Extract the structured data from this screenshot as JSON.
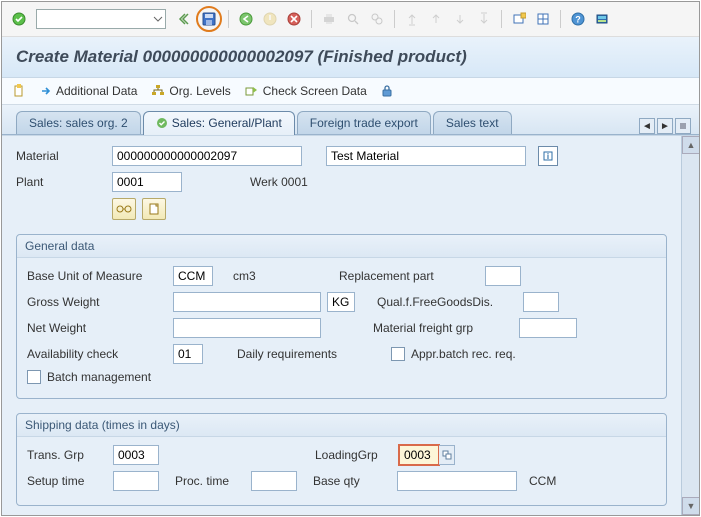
{
  "toolbar": {
    "combo_value": ""
  },
  "title": "Create Material 000000000000002097 (Finished product)",
  "subtoolbar": {
    "additional_data": "Additional Data",
    "org_levels": "Org. Levels",
    "check_screen": "Check Screen Data"
  },
  "tabs": {
    "t1": "Sales: sales org. 2",
    "t2": "Sales: General/Plant",
    "t3": "Foreign trade export",
    "t4": "Sales text"
  },
  "header": {
    "material_label": "Material",
    "material_value": "000000000000002097",
    "material_desc": "Test Material",
    "plant_label": "Plant",
    "plant_value": "0001",
    "plant_desc": "Werk 0001"
  },
  "general": {
    "title": "General data",
    "uom_label": "Base Unit of Measure",
    "uom_value": "CCM",
    "uom_desc": "cm3",
    "replacement_label": "Replacement part",
    "gross_label": "Gross Weight",
    "gross_value": "",
    "gross_unit": "KG",
    "qualfree_label": "Qual.f.FreeGoodsDis.",
    "net_label": "Net Weight",
    "net_value": "",
    "mfg_label": "Material freight grp",
    "mfg_value": "",
    "avail_label": "Availability check",
    "avail_value": "01",
    "avail_desc": "Daily requirements",
    "apprbatch_label": "Appr.batch rec. req.",
    "batchmgmt_label": "Batch management"
  },
  "shipping": {
    "title": "Shipping data (times in days)",
    "transgrp_label": "Trans. Grp",
    "transgrp_value": "0003",
    "loadgrp_label": "LoadingGrp",
    "loadgrp_value": "0003",
    "setup_label": "Setup time",
    "setup_value": "",
    "proc_label": "Proc. time",
    "proc_value": "",
    "baseqty_label": "Base qty",
    "baseqty_value": "",
    "baseqty_unit": "CCM"
  }
}
